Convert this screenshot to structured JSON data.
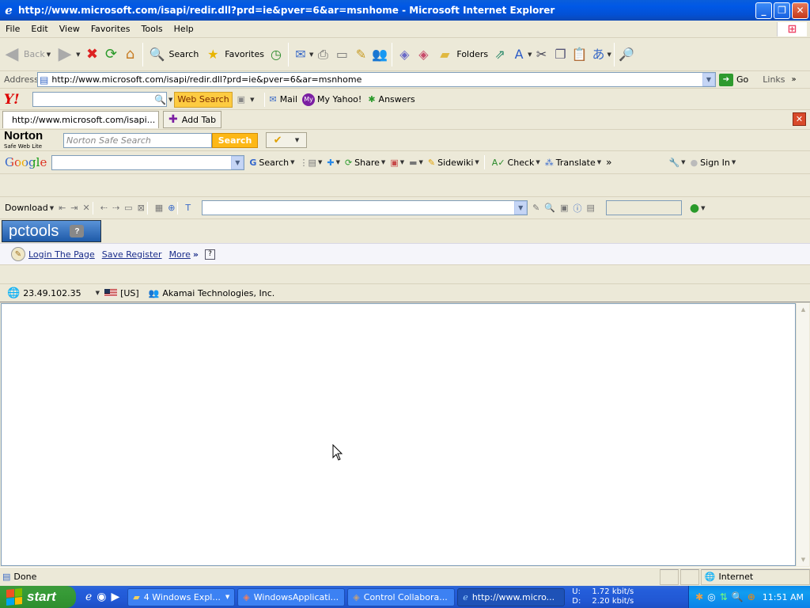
{
  "window": {
    "title": "http://www.microsoft.com/isapi/redir.dll?prd=ie&pver=6&ar=msnhome - Microsoft Internet Explorer"
  },
  "menu": [
    "File",
    "Edit",
    "View",
    "Favorites",
    "Tools",
    "Help"
  ],
  "toolbar": {
    "back": "Back",
    "search": "Search",
    "favorites": "Favorites",
    "folders": "Folders"
  },
  "address": {
    "label": "Address",
    "url": "http://www.microsoft.com/isapi/redir.dll?prd=ie&pver=6&ar=msnhome",
    "go": "Go",
    "links": "Links"
  },
  "yahoo": {
    "logo": "Y!",
    "web_search": "Web Search",
    "mail": "Mail",
    "my_yahoo": "My Yahoo!",
    "answers": "Answers",
    "my_badge": "My"
  },
  "tabs": {
    "current": "http://www.microsoft.com/isapi...",
    "add": "Add Tab"
  },
  "norton": {
    "brand": "Norton",
    "sub": "Safe Web Lite",
    "placeholder": "Norton Safe Search",
    "button": "Search"
  },
  "google": {
    "logo": "Google",
    "search": "Search",
    "share": "Share",
    "sidewiki": "Sidewiki",
    "check": "Check",
    "translate": "Translate",
    "sign_in": "Sign In"
  },
  "downloadbar": {
    "download": "Download"
  },
  "pctools": {
    "logo": "pctools",
    "help": "?"
  },
  "loginbar": {
    "login": "Login The Page",
    "save": "Save Register",
    "more": "More",
    "help": "?"
  },
  "ipbar": {
    "ip": "23.49.102.35",
    "country": "[US]",
    "org": "Akamai Technologies, Inc."
  },
  "status": {
    "text": "Done",
    "zone": "Internet"
  },
  "taskbar": {
    "start": "start",
    "tasks": [
      {
        "label": "4 Windows Expl...",
        "active": false
      },
      {
        "label": "WindowsApplicati...",
        "active": false
      },
      {
        "label": "Control Collabora...",
        "active": false
      },
      {
        "label": "http://www.micro...",
        "active": true
      }
    ],
    "net_up_label": "U:",
    "net_down_label": "D:",
    "net_up": "1.72 kbit/s",
    "net_down": "2.20 kbit/s",
    "clock": "11:51 AM"
  }
}
